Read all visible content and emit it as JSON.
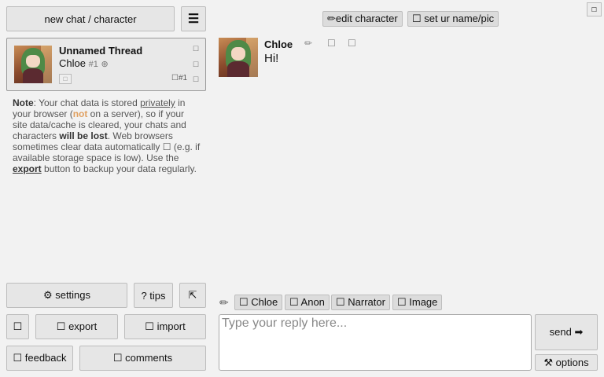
{
  "sidebar": {
    "new_chat_label": "new chat / character",
    "new_chat_icon": "☐",
    "menu_icon": "☰",
    "thread": {
      "title": "Unnamed Thread",
      "character": "Chloe",
      "number": "#1",
      "link_icon": "⊕",
      "count": "☐#1",
      "tiny_box": "☐",
      "side_icons": [
        "☐",
        "☐",
        "☐"
      ]
    },
    "note": {
      "label": "Note",
      "t1": ": Your chat data is stored ",
      "privately": "privately",
      "t2": " in your browser (",
      "not": "not",
      "t3": " on a server), so if your site data/cache is cleared, your chats and characters ",
      "will_be_lost": "will be lost",
      "t4": ". Web browsers sometimes clear data automatically ☐ (e.g. if available storage space is low). Use the ",
      "export": "export",
      "t5": " button to backup your data regularly."
    },
    "settings_label": "⚙ settings",
    "tips_label": "? tips",
    "collapse_icon": "⇱",
    "box_icon": "☐",
    "export_label": "☐ export",
    "import_label": "☐ import",
    "feedback_label": "☐ feedback",
    "comments_label": "☐ comments"
  },
  "header": {
    "edit_character": "✏edit character",
    "set_name": "☐ set ur name/pic",
    "corner_icon": "☐"
  },
  "message": {
    "name": "Chloe",
    "edit_icon": "✏",
    "action2": "☐",
    "action3": "☐",
    "text": "Hi!"
  },
  "composer": {
    "pencil_icon": "✏",
    "chips": [
      "☐ Chloe",
      "☐ Anon",
      "☐ Narrator",
      "☐ Image"
    ],
    "placeholder": "Type your reply here...",
    "send_label": "send ➡",
    "options_label": "⚒ options"
  }
}
